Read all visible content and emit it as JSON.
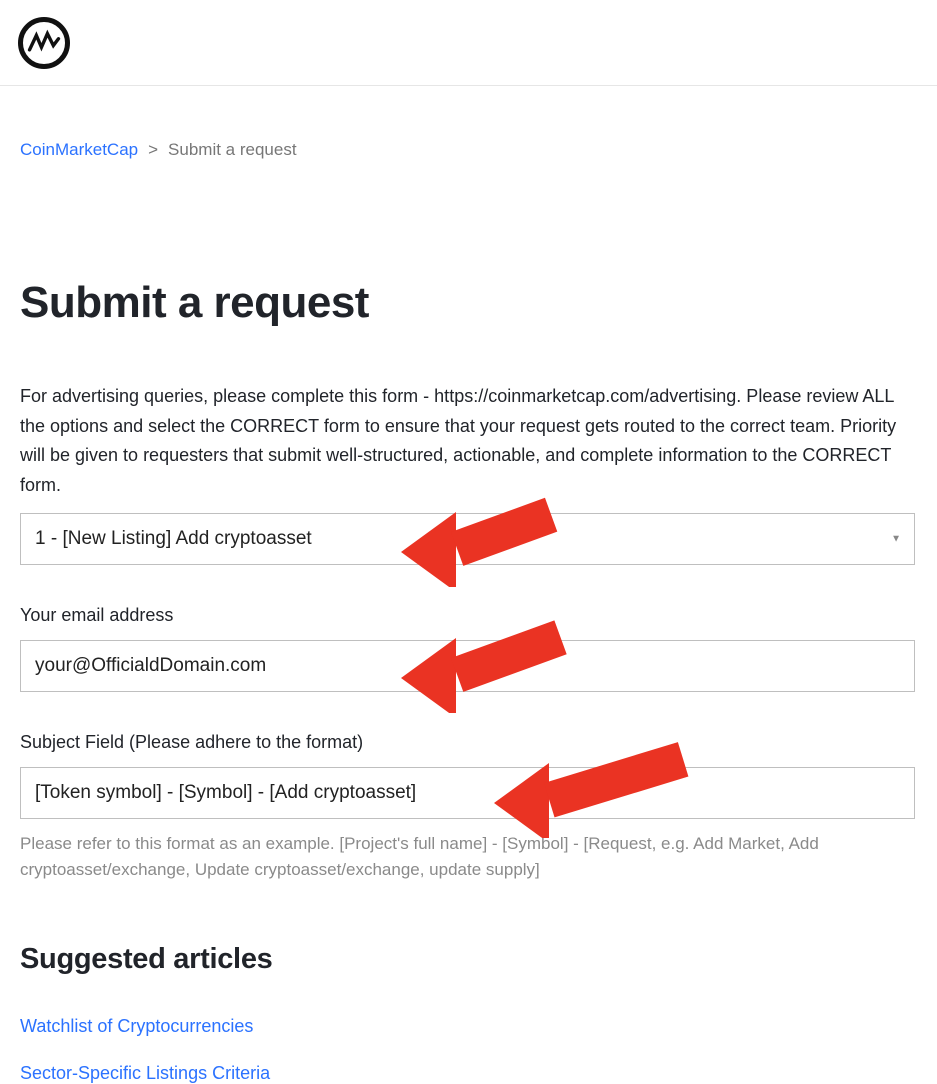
{
  "breadcrumb": {
    "home": "CoinMarketCap",
    "sep": ">",
    "current": "Submit a request"
  },
  "page_title": "Submit a request",
  "intro_text": "For advertising queries, please complete this form - https://coinmarketcap.com/advertising. Please review ALL the options and select the CORRECT form to ensure that your request gets routed to the correct team. Priority will be given to requesters that submit well-structured, actionable, and complete information to the CORRECT form.",
  "form": {
    "request_type_value": "1 - [New Listing] Add cryptoasset",
    "email_label": "Your email address",
    "email_value": "your@OfficialdDomain.com",
    "subject_label": "Subject Field (Please adhere to the format)",
    "subject_value": "[Token symbol] - [Symbol] - [Add cryptoasset]",
    "subject_help": "Please refer to this format as an example. [Project's full name] - [Symbol] - [Request, e.g. Add Market, Add cryptoasset/exchange, Update cryptoasset/exchange, update supply]"
  },
  "suggested_heading": "Suggested articles",
  "suggested_links": {
    "a1": "Watchlist of Cryptocurrencies",
    "a2": "Sector-Specific Listings Criteria"
  }
}
